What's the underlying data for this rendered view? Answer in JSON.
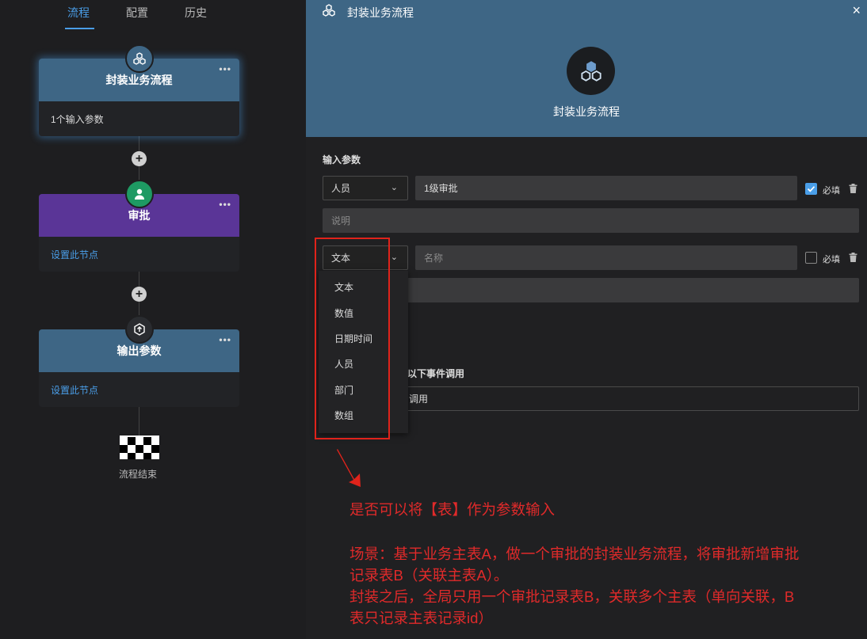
{
  "tabs": {
    "flow": "流程",
    "config": "配置",
    "history": "历史"
  },
  "nodes": {
    "start": {
      "title": "封装业务流程",
      "body": "1个输入参数",
      "more": "•••"
    },
    "approve": {
      "title": "审批",
      "body": "设置此节点",
      "more": "•••"
    },
    "output": {
      "title": "输出参数",
      "body": "设置此节点",
      "more": "•••"
    }
  },
  "add_label": "+",
  "finish_label": "流程结束",
  "panel": {
    "header_title": "封装业务流程",
    "name": "封装业务流程",
    "close": "×",
    "input_params_label": "输入参数",
    "param1": {
      "type": "人员",
      "name": "1级审批",
      "desc_placeholder": "说明",
      "required_label": "必填"
    },
    "param2": {
      "type": "文本",
      "name_placeholder": "名称",
      "required_label": "必填"
    },
    "event_label": "以下事件调用",
    "event_value": "调用"
  },
  "dropdown": {
    "items": [
      "文本",
      "数值",
      "日期时间",
      "人员",
      "部门",
      "数组"
    ]
  },
  "annotation": {
    "question": "是否可以将【表】作为参数输入",
    "scenario_line1": "场景：基于业务主表A，做一个审批的封装业务流程，将审批新增审批",
    "scenario_line2": "记录表B（关联主表A）。",
    "scenario_line3": "封装之后，全局只用一个审批记录表B，关联多个主表（单向关联，B",
    "scenario_line4": "表只记录主表记录id）"
  },
  "colors": {
    "accent": "#4a9ee8",
    "approve_head": "#5a3597",
    "start_head": "#3e6685",
    "approve_icon": "#1e9a63",
    "annotation": "#e02a2a"
  }
}
